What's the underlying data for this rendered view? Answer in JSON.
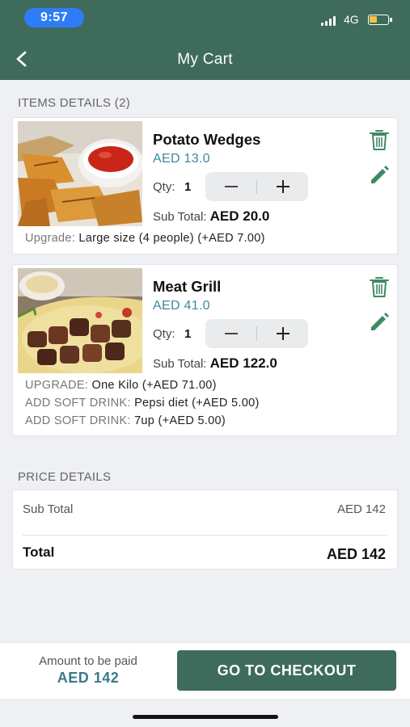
{
  "status_bar": {
    "time": "9:57",
    "network": "4G"
  },
  "header": {
    "title": "My Cart",
    "back_icon": "chevron-left-icon"
  },
  "items_section": {
    "label": "ITEMS DETAILS (2)",
    "items": [
      {
        "name": "Potato Wedges",
        "price": "AED 13.0",
        "qty_label": "Qty:",
        "qty": "1",
        "subtotal_label": "Sub Total:",
        "subtotal": "AED 20.0",
        "options": [
          {
            "label": "Upgrade:",
            "value": "Large size (4 people)",
            "price": "(+AED 7.00)"
          }
        ]
      },
      {
        "name": "Meat Grill",
        "price": "AED 41.0",
        "qty_label": "Qty:",
        "qty": "1",
        "subtotal_label": "Sub Total:",
        "subtotal": "AED 122.0",
        "options": [
          {
            "label": "UPGRADE:",
            "value": "One Kilo",
            "price": "(+AED 71.00)"
          },
          {
            "label": "ADD SOFT DRINK:",
            "value": "Pepsi diet",
            "price": "(+AED 5.00)"
          },
          {
            "label": "ADD SOFT DRINK:",
            "value": "7up",
            "price": "(+AED 5.00)"
          }
        ]
      }
    ]
  },
  "price_details": {
    "label": "PRICE DETAILS",
    "subtotal_label": "Sub Total",
    "subtotal_value": "AED 142",
    "total_label": "Total",
    "total_value": "AED 142"
  },
  "bottom_bar": {
    "amount_label": "Amount to be paid",
    "amount_value": "AED 142",
    "checkout_label": "GO TO CHECKOUT"
  },
  "colors": {
    "primary": "#3e6b5c",
    "accent_price": "#3b8b9a",
    "icon_green": "#3f8a63",
    "time_pill": "#2e7df6"
  },
  "icons": [
    "chevron-left-icon",
    "trash-icon",
    "pencil-icon",
    "minus-icon",
    "plus-icon",
    "signal-icon",
    "battery-icon"
  ]
}
